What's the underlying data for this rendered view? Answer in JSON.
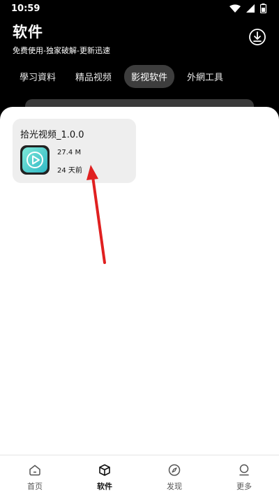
{
  "status_bar": {
    "time": "10:59",
    "icons": [
      "wifi-icon",
      "signal-icon",
      "battery-icon"
    ]
  },
  "header": {
    "title": "软件",
    "subtitle": "免费使用-独家破解-更新迅速",
    "download_icon": "download-icon"
  },
  "tabs": [
    {
      "label": "學习資料",
      "active": false
    },
    {
      "label": "精品视频",
      "active": false
    },
    {
      "label": "影视软件",
      "active": true
    },
    {
      "label": "外網工具",
      "active": false
    }
  ],
  "cards": [
    {
      "title": "拾光视频_1.0.0",
      "size": "27.4 M",
      "time": "24 天前",
      "icon": "play-icon"
    }
  ],
  "bottom_nav": [
    {
      "label": "首页",
      "icon": "home-icon",
      "active": false
    },
    {
      "label": "软件",
      "icon": "cube-icon",
      "active": true
    },
    {
      "label": "发现",
      "icon": "compass-icon",
      "active": false
    },
    {
      "label": "更多",
      "icon": "person-icon",
      "active": false
    }
  ],
  "colors": {
    "background": "#000000",
    "sheet": "#ffffff",
    "card": "#eeeeee",
    "active_tab": "#3d3d3d",
    "app_icon_accent": "#3ed1c5",
    "annotation_arrow": "#e02020"
  }
}
